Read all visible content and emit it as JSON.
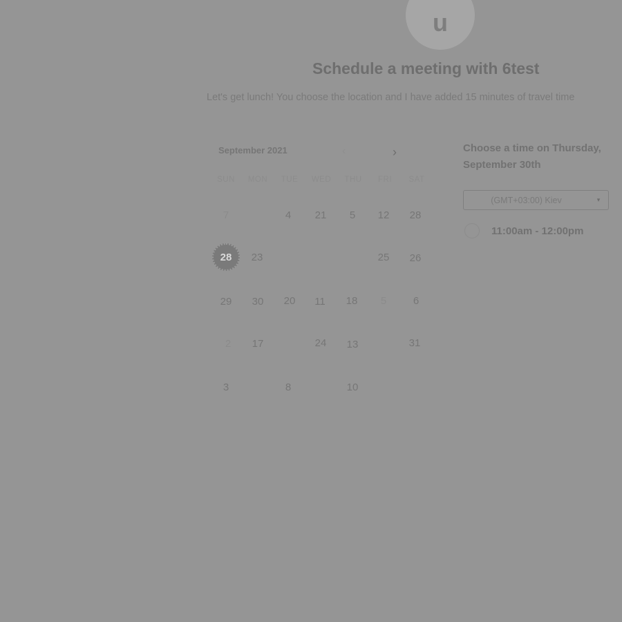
{
  "host": {
    "avatar_letter": "u",
    "title": "Schedule a meeting with 6test",
    "description": "Let's get lunch! You choose the location and I have added 15 minutes of travel time"
  },
  "calendar": {
    "month_label": "September 2021",
    "prev_icon": "chevron-left-icon",
    "next_icon": "chevron-right-icon",
    "weekdays": [
      "SUN",
      "MON",
      "TUE",
      "WED",
      "THU",
      "FRI",
      "SAT"
    ],
    "rows": [
      [
        "7",
        "",
        "4",
        "21",
        "5",
        "12",
        "28"
      ],
      [
        "28",
        "23",
        "",
        "",
        "",
        "25",
        "26"
      ],
      [
        "29",
        "30",
        "20",
        "11",
        "18",
        "5",
        "6"
      ],
      [
        "2",
        "17",
        "",
        "24",
        "13",
        "",
        "31"
      ],
      [
        "3",
        "",
        "8",
        "",
        "10",
        "",
        ""
      ]
    ],
    "selected_date": "28"
  },
  "slots": {
    "heading": "Choose a time on Thursday, September 30th",
    "timezone": "(GMT+03:00) Kiev",
    "timezone_caret_icon": "caret-down-icon",
    "times": [
      "11:00am - 12:00pm"
    ]
  }
}
